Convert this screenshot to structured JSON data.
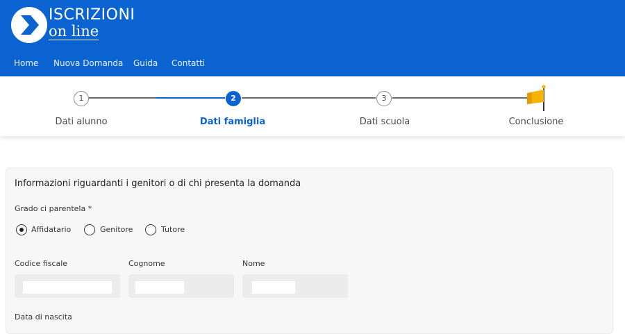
{
  "brand": {
    "title": "ISCRIZIONI",
    "subtitle": "on line",
    "color": "#0b63d1"
  },
  "nav": {
    "items": [
      "Home",
      "Nuova Domanda",
      "Guida",
      "Contatti"
    ]
  },
  "stepper": {
    "steps": [
      {
        "number": "1",
        "label": "Dati alunno",
        "state": "done"
      },
      {
        "number": "2",
        "label": "Dati famiglia",
        "state": "active"
      },
      {
        "number": "3",
        "label": "Dati scuola",
        "state": "pending"
      },
      {
        "number": "",
        "label": "Conclusione",
        "state": "pending",
        "icon": "flag-icon"
      }
    ]
  },
  "form": {
    "section_title": "Informazioni riguardanti i genitori o di chi presenta la domanda",
    "relationship": {
      "label": "Grado ci parentela *",
      "options": [
        "Affidatario",
        "Genitore",
        "Tutore"
      ],
      "selected": "Affidatario"
    },
    "fields": {
      "codice_fiscale": "Codice fiscale",
      "cognome": "Cognome",
      "nome": "Nome",
      "data_nascita": "Data di nascita"
    }
  }
}
